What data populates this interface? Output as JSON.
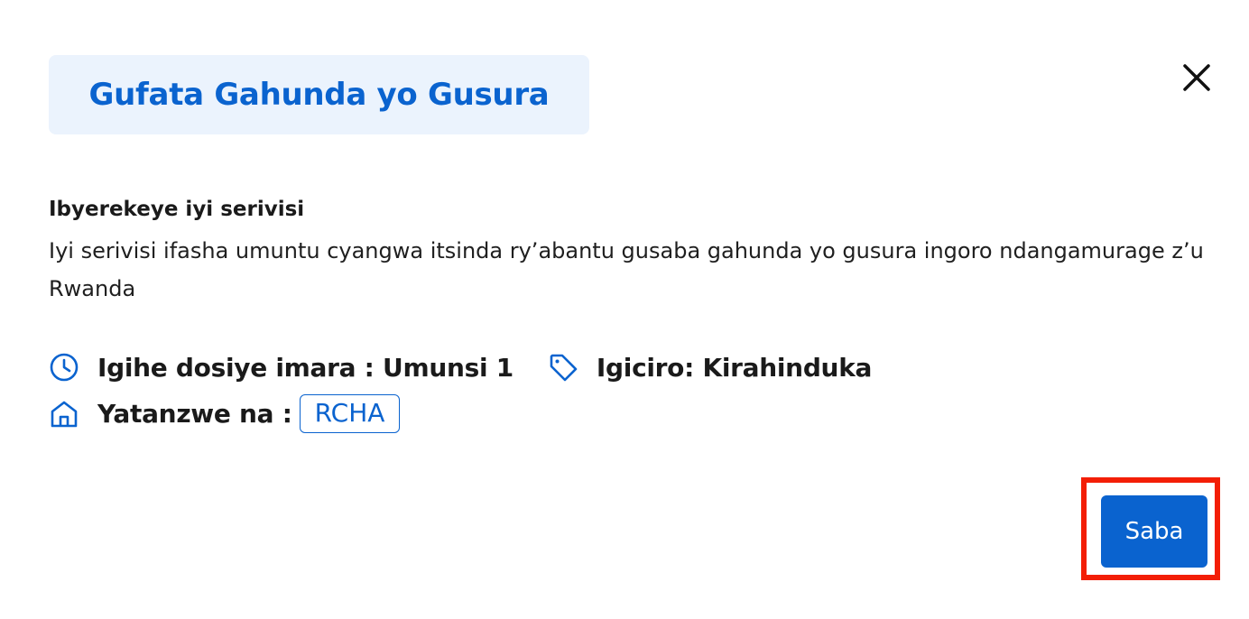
{
  "modal": {
    "title": "Gufata Gahunda yo Gusura",
    "close_icon": "close-icon"
  },
  "about": {
    "heading": "Ibyerekeye iyi serivisi",
    "description": "Iyi serivisi ifasha umuntu cyangwa itsinda ry’abantu gusaba gahunda yo gusura ingoro ndangamurage z’u Rwanda"
  },
  "meta": {
    "processing_time": "Igihe dosiye imara : Umunsi 1",
    "processing_time_icon": "clock-icon",
    "price": "Igiciro: Kirahinduka",
    "price_icon": "tag-icon",
    "provider_label": "Yatanzwe na :",
    "provider_icon": "home-icon",
    "provider_badge": "RCHA"
  },
  "actions": {
    "apply_label": "Saba",
    "highlight_color": "#f31e06"
  },
  "colors": {
    "primary": "#0a63cf",
    "title_bg": "#ebf3fd",
    "text": "#1a1a1a"
  }
}
